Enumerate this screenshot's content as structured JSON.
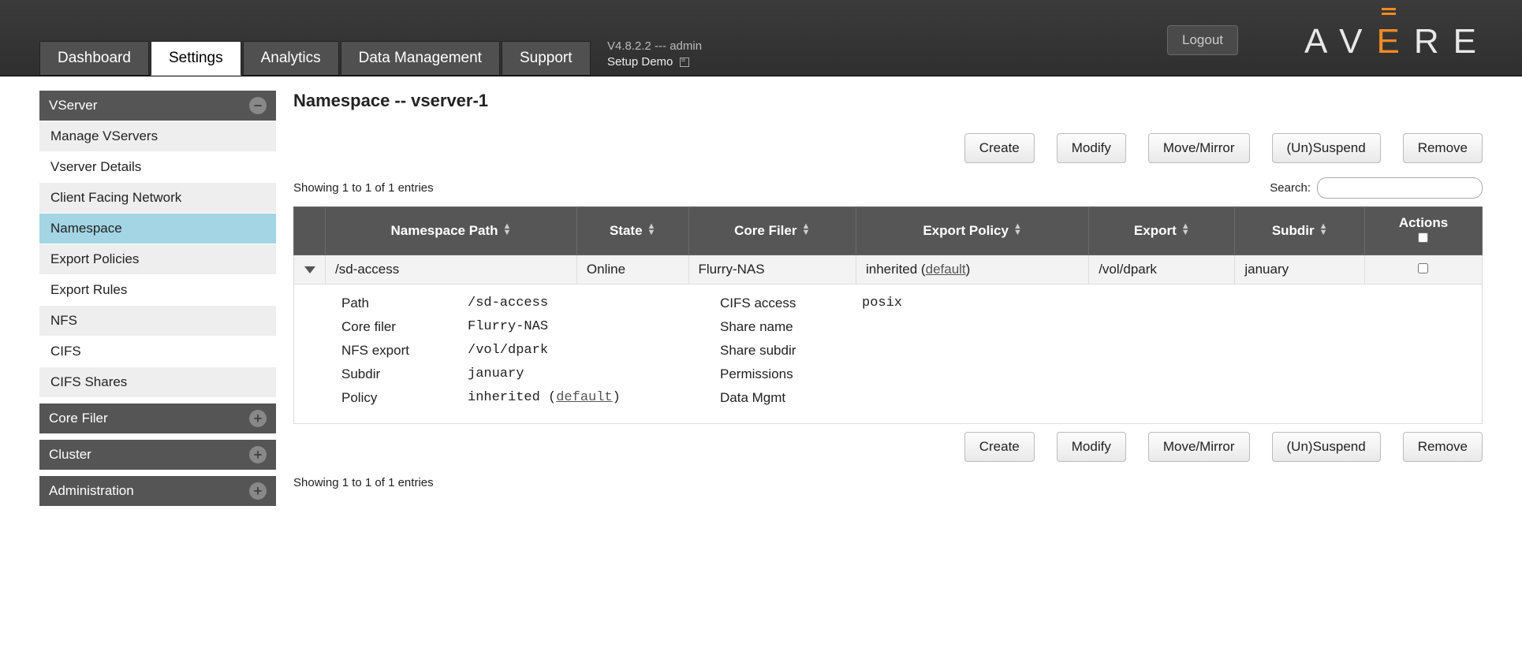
{
  "header": {
    "logout_label": "Logout",
    "version_line": "V4.8.2.2 --- admin",
    "setup_label": "Setup Demo",
    "logo_letters": [
      "A",
      "V",
      "E",
      "R",
      "E"
    ],
    "tabs": [
      {
        "label": "Dashboard",
        "active": false
      },
      {
        "label": "Settings",
        "active": true
      },
      {
        "label": "Analytics",
        "active": false
      },
      {
        "label": "Data Management",
        "active": false
      },
      {
        "label": "Support",
        "active": false
      }
    ]
  },
  "sidebar": {
    "groups": [
      {
        "label": "VServer",
        "expanded": true,
        "items": [
          {
            "label": "Manage VServers"
          },
          {
            "label": "Vserver Details"
          },
          {
            "label": "Client Facing Network"
          },
          {
            "label": "Namespace",
            "selected": true
          },
          {
            "label": "Export Policies"
          },
          {
            "label": "Export Rules"
          },
          {
            "label": "NFS"
          },
          {
            "label": "CIFS"
          },
          {
            "label": "CIFS Shares"
          }
        ]
      },
      {
        "label": "Core Filer",
        "expanded": false
      },
      {
        "label": "Cluster",
        "expanded": false
      },
      {
        "label": "Administration",
        "expanded": false
      }
    ]
  },
  "page": {
    "title": "Namespace -- vserver-1",
    "buttons": {
      "create": "Create",
      "modify": "Modify",
      "move": "Move/Mirror",
      "suspend": "(Un)Suspend",
      "remove": "Remove"
    },
    "showing_text_top": "Showing 1 to 1 of 1 entries",
    "showing_text_bottom": "Showing 1 to 1 of 1 entries",
    "search_label": "Search:",
    "search_value": "",
    "columns": {
      "path": "Namespace Path",
      "state": "State",
      "core_filer": "Core Filer",
      "policy": "Export Policy",
      "export": "Export",
      "subdir": "Subdir",
      "actions": "Actions"
    },
    "row": {
      "path": "/sd-access",
      "state": "Online",
      "core_filer": "Flurry-NAS",
      "policy_prefix": "inherited (",
      "policy_link": "default",
      "policy_suffix": ")",
      "export": "/vol/dpark",
      "subdir": "january"
    },
    "details": {
      "left_labels": {
        "path": "Path",
        "core_filer": "Core filer",
        "nfs_export": "NFS export",
        "subdir": "Subdir",
        "policy": "Policy"
      },
      "left_values": {
        "path": "/sd-access",
        "core_filer": "Flurry-NAS",
        "nfs_export": "/vol/dpark",
        "subdir": "january",
        "policy_prefix": "inherited (",
        "policy_link": "default",
        "policy_suffix": ")"
      },
      "right_labels": {
        "cifs_access": "CIFS access",
        "share_name": "Share name",
        "share_subdir": "Share subdir",
        "permissions": "Permissions",
        "data_mgmt": "Data Mgmt"
      },
      "right_values": {
        "cifs_access": "posix",
        "share_name": "",
        "share_subdir": "",
        "permissions": "",
        "data_mgmt": ""
      }
    }
  }
}
